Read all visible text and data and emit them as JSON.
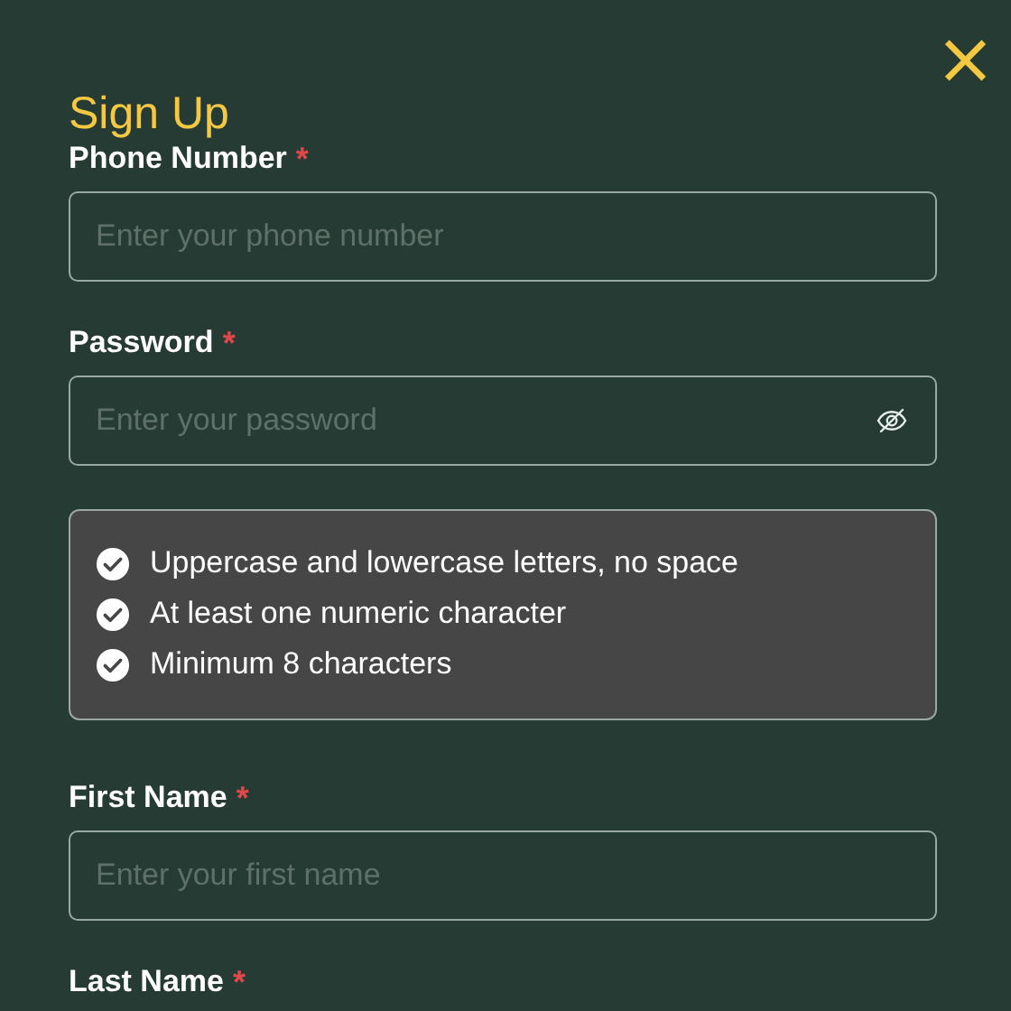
{
  "dialog": {
    "title": "Sign Up",
    "close": "×"
  },
  "fields": [
    {
      "kind": "text",
      "label": "Phone Number",
      "required": true,
      "marker": "*",
      "placeholder": "Enter your phone number"
    },
    {
      "kind": "password",
      "label": "Password",
      "required": true,
      "marker": "*",
      "placeholder": "Enter your password"
    },
    {
      "kind": "rules",
      "rules": [
        {
          "text": "Uppercase and lowercase letters, no space",
          "met": true
        },
        {
          "text": "At least one numeric character",
          "met": true
        },
        {
          "text": "Minimum 8 characters",
          "met": true
        }
      ]
    },
    {
      "kind": "text",
      "label": "First Name",
      "required": true,
      "marker": "*",
      "placeholder": "Enter your first name"
    },
    {
      "kind": "text",
      "label": "Last Name",
      "required": true,
      "marker": "*"
    }
  ]
}
